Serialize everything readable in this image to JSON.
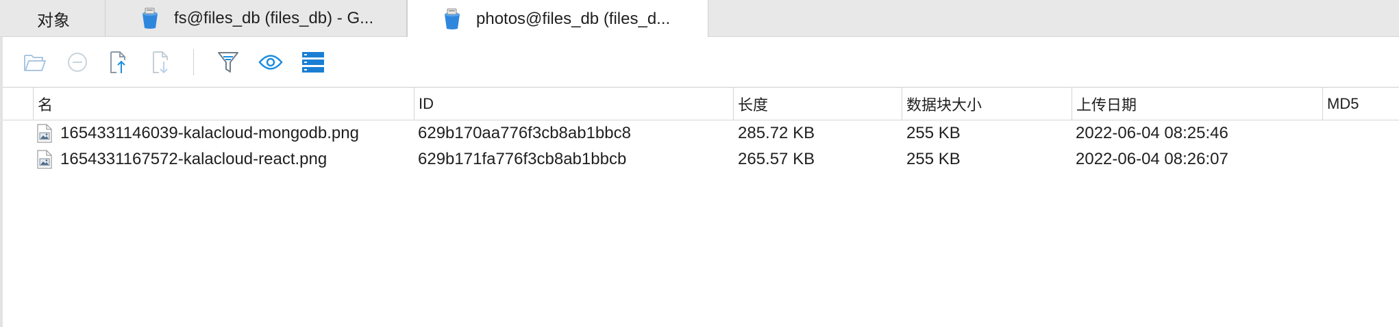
{
  "tabs": [
    {
      "label": "对象",
      "icon": "none"
    },
    {
      "label": "fs@files_db (files_db) - G...",
      "icon": "mongodb-bucket-icon"
    },
    {
      "label": "photos@files_db (files_d...",
      "icon": "mongodb-bucket-icon",
      "active": true
    }
  ],
  "toolbar": {
    "icons": [
      "open-folder-icon",
      "remove-icon",
      "upload-icon",
      "download-icon",
      "filter-icon",
      "preview-icon",
      "stack-view-icon"
    ],
    "accent_color": "#1a8ce0",
    "disabled_color": "#b9c9d9"
  },
  "grid": {
    "columns": [
      "名",
      "ID",
      "长度",
      "数据块大小",
      "上传日期",
      "MD5"
    ],
    "rows": [
      {
        "name": "1654331146039-kalacloud-mongodb.png",
        "id": "629b170aa776f3cb8ab1bbc8",
        "length": "285.72 KB",
        "chunk_size": "255 KB",
        "upload_date": "2022-06-04 08:25:46",
        "md5": ""
      },
      {
        "name": "1654331167572-kalacloud-react.png",
        "id": "629b171fa776f3cb8ab1bbcb",
        "length": "265.57 KB",
        "chunk_size": "255 KB",
        "upload_date": "2022-06-04 08:26:07",
        "md5": ""
      }
    ]
  }
}
